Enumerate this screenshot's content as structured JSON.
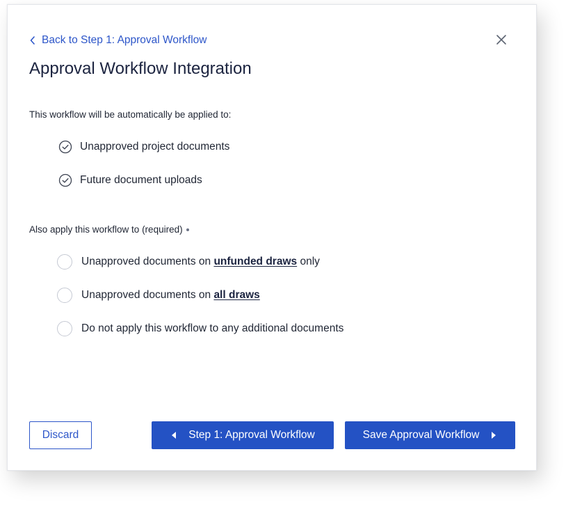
{
  "dialog": {
    "back_link": "Back to Step 1: Approval Workflow",
    "title": "Approval Workflow Integration",
    "close_icon": "close-icon"
  },
  "applied": {
    "intro": "This workflow will be automatically be applied to:",
    "items": [
      {
        "label": "Unapproved project documents",
        "icon": "check-circle-icon"
      },
      {
        "label": "Future document uploads",
        "icon": "check-circle-icon"
      }
    ]
  },
  "also_apply": {
    "label": "Also apply this workflow to (required)",
    "options": [
      {
        "prefix": "Unapproved documents on ",
        "emphasis": "unfunded draws",
        "suffix": " only",
        "selected": false
      },
      {
        "prefix": "Unapproved documents on ",
        "emphasis": "all draws",
        "suffix": "",
        "selected": false
      },
      {
        "prefix": "Do not apply this workflow to any additional documents",
        "emphasis": "",
        "suffix": "",
        "selected": false
      }
    ]
  },
  "footer": {
    "discard_label": "Discard",
    "step1_label": "Step 1: Approval Workflow",
    "save_label": "Save Approval Workflow"
  },
  "colors": {
    "accent": "#2452c4",
    "link": "#2d56c9",
    "text": "#222836",
    "title": "#1c2440"
  }
}
